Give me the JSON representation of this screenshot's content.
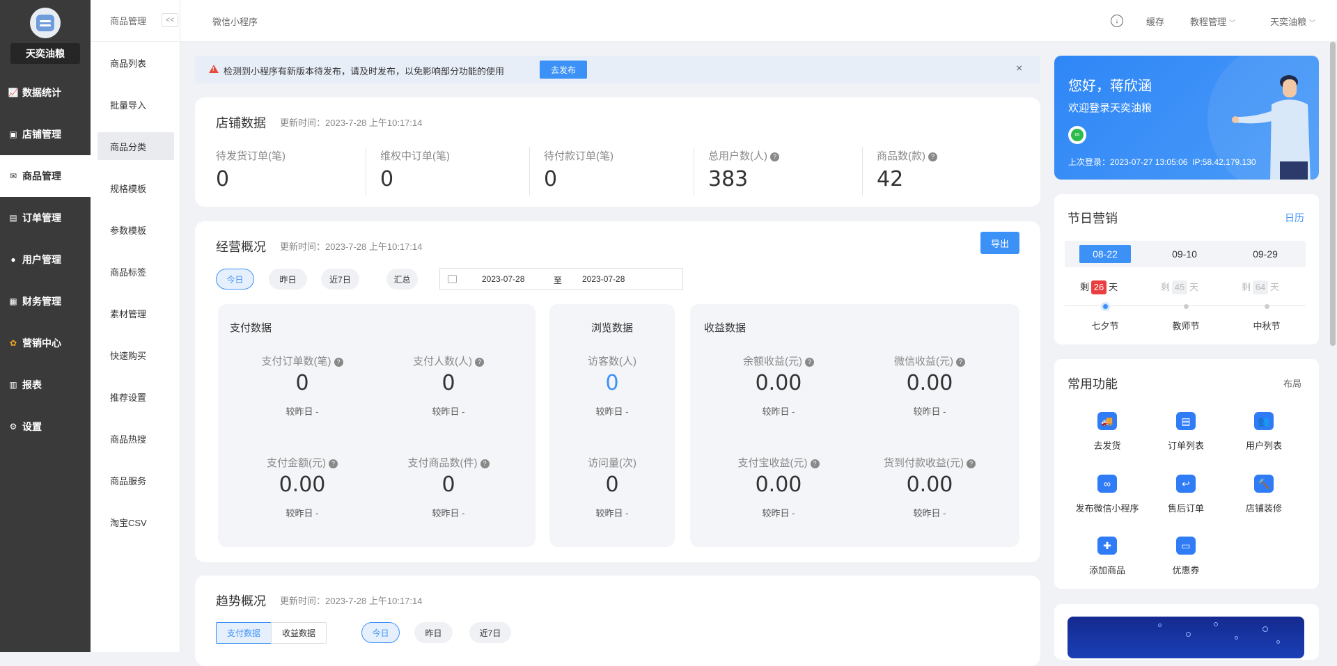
{
  "sidebar": {
    "shop_name": "天奕油粮",
    "items": [
      {
        "label": "数据统计",
        "icon": "chart-line-icon"
      },
      {
        "label": "店铺管理",
        "icon": "store-icon"
      },
      {
        "label": "商品管理",
        "icon": "goods-icon"
      },
      {
        "label": "订单管理",
        "icon": "order-icon"
      },
      {
        "label": "用户管理",
        "icon": "user-icon"
      },
      {
        "label": "财务管理",
        "icon": "finance-icon"
      },
      {
        "label": "营销中心",
        "icon": "marketing-icon"
      },
      {
        "label": "报表",
        "icon": "report-icon"
      },
      {
        "label": "设置",
        "icon": "gear-icon"
      }
    ],
    "active": "商品管理"
  },
  "subnav": {
    "title": "商品管理",
    "collapse": "<<",
    "items": [
      "商品列表",
      "批量导入",
      "商品分类",
      "规格模板",
      "参数模板",
      "商品标签",
      "素材管理",
      "快速购买",
      "推荐设置",
      "商品热搜",
      "商品服务",
      "淘宝CSV"
    ],
    "active": "商品分类"
  },
  "topbar": {
    "breadcrumb": "微信小程序",
    "cache": "缓存",
    "tutorial": "教程管理",
    "user": "天奕油粮"
  },
  "alert": {
    "message": "检测到小程序有新版本待发布，请及时发布，以免影响部分功能的使用",
    "button": "去发布",
    "close": "×"
  },
  "store": {
    "title": "店铺数据",
    "updated": "更新时间：2023-7-28 上午10:17:14",
    "stats": [
      {
        "label": "待发货订单(笔)",
        "value": "0"
      },
      {
        "label": "维权中订单(笔)",
        "value": "0"
      },
      {
        "label": "待付款订单(笔)",
        "value": "0"
      },
      {
        "label": "总用户数(人)",
        "value": "383"
      },
      {
        "label": "商品数(款)",
        "value": "42"
      }
    ]
  },
  "overview": {
    "title": "经营概况",
    "updated": "更新时间：2023-7-28 上午10:17:14",
    "export": "导出",
    "ranges": [
      "今日",
      "昨日",
      "近7日",
      "汇总"
    ],
    "active_range": "今日",
    "date_start": "2023-07-28",
    "date_sep": "至",
    "date_end": "2023-07-28",
    "pay": {
      "title": "支付数据",
      "metrics": [
        {
          "label": "支付订单数(笔)",
          "value": "0",
          "cmp": "较昨日 -"
        },
        {
          "label": "支付人数(人)",
          "value": "0",
          "cmp": "较昨日 -"
        },
        {
          "label": "支付金额(元)",
          "value": "0.00",
          "cmp": "较昨日 -"
        },
        {
          "label": "支付商品数(件)",
          "value": "0",
          "cmp": "较昨日 -"
        }
      ]
    },
    "browse": {
      "title": "浏览数据",
      "metrics": [
        {
          "label": "访客数(人)",
          "value": "0",
          "cmp": "较昨日 -"
        },
        {
          "label": "访问量(次)",
          "value": "0",
          "cmp": "较昨日 -"
        }
      ]
    },
    "income": {
      "title": "收益数据",
      "metrics": [
        {
          "label": "余额收益(元)",
          "value": "0.00",
          "cmp": "较昨日 -"
        },
        {
          "label": "微信收益(元)",
          "value": "0.00",
          "cmp": "较昨日 -"
        },
        {
          "label": "支付宝收益(元)",
          "value": "0.00",
          "cmp": "较昨日 -"
        },
        {
          "label": "货到付款收益(元)",
          "value": "0.00",
          "cmp": "较昨日 -"
        }
      ]
    }
  },
  "trend": {
    "title": "趋势概况",
    "updated": "更新时间：2023-7-28 上午10:17:14",
    "tabs": [
      "支付数据",
      "收益数据"
    ],
    "ranges": [
      "今日",
      "昨日",
      "近7日"
    ]
  },
  "welcome": {
    "greeting": "您好，蒋欣涵",
    "sub": "欢迎登录天奕油粮",
    "last_login": "上次登录：2023-07-27 13:05:06",
    "ip": "IP:58.42.179.130"
  },
  "festival": {
    "title": "节日营销",
    "calendar": "日历",
    "dates": [
      "08-22",
      "09-10",
      "09-29"
    ],
    "items": [
      {
        "prefix": "剩",
        "days": "26",
        "suffix": "天",
        "name": "七夕节"
      },
      {
        "prefix": "剩",
        "days": "45",
        "suffix": "天",
        "name": "教师节"
      },
      {
        "prefix": "剩",
        "days": "64",
        "suffix": "天",
        "name": "中秋节"
      }
    ]
  },
  "functions": {
    "title": "常用功能",
    "layout": "布局",
    "items": [
      {
        "label": "去发货",
        "icon": "delivery-truck-icon"
      },
      {
        "label": "订单列表",
        "icon": "order-list-icon"
      },
      {
        "label": "用户列表",
        "icon": "users-icon"
      },
      {
        "label": "发布微信小程序",
        "icon": "mini-program-icon"
      },
      {
        "label": "售后订单",
        "icon": "after-sale-icon"
      },
      {
        "label": "店铺装修",
        "icon": "decorate-icon"
      },
      {
        "label": "添加商品",
        "icon": "add-goods-icon"
      },
      {
        "label": "优惠券",
        "icon": "coupon-icon"
      }
    ]
  },
  "colors": {
    "accent": "#3c91f7",
    "sidebar": "#3a3a3a",
    "danger": "#ea3f3f"
  }
}
